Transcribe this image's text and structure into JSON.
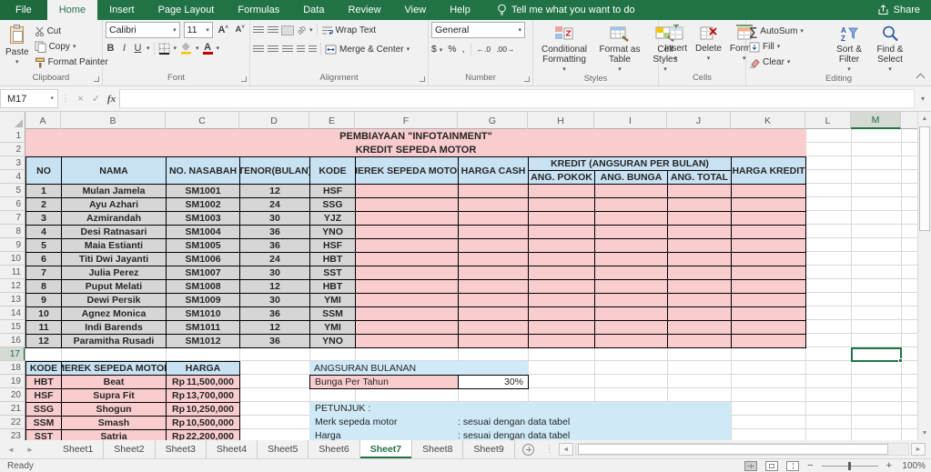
{
  "ribbon": {
    "file_tab": "File",
    "tabs": [
      "Home",
      "Insert",
      "Page Layout",
      "Formulas",
      "Data",
      "Review",
      "View",
      "Help"
    ],
    "active_tab": "Home",
    "tell_me": "Tell me what you want to do",
    "share": "Share",
    "groups": {
      "clipboard": {
        "label": "Clipboard",
        "paste": "Paste",
        "cut": "Cut",
        "copy": "Copy",
        "format_painter": "Format Painter"
      },
      "font": {
        "label": "Font",
        "font_name": "Calibri",
        "font_size": "11",
        "bold": "B",
        "italic": "I",
        "underline": "U"
      },
      "alignment": {
        "label": "Alignment",
        "wrap_text": "Wrap Text",
        "merge_center": "Merge & Center"
      },
      "number": {
        "label": "Number",
        "format": "General",
        "currency": "$",
        "percent": "%",
        "comma": ",",
        "inc_decimal": "←.0",
        "dec_decimal": ".00→"
      },
      "styles": {
        "label": "Styles",
        "conditional": "Conditional Formatting",
        "format_table": "Format as Table",
        "cell_styles": "Cell Styles"
      },
      "cells": {
        "label": "Cells",
        "insert": "Insert",
        "delete": "Delete",
        "format": "Format"
      },
      "editing": {
        "label": "Editing",
        "autosum": "AutoSum",
        "fill": "Fill",
        "clear": "Clear",
        "sort": "Sort & Filter",
        "find": "Find & Select"
      }
    }
  },
  "formula_bar": {
    "name_box": "M17",
    "fx": "fx",
    "formula": ""
  },
  "grid": {
    "columns": [
      "A",
      "B",
      "C",
      "D",
      "E",
      "F",
      "G",
      "H",
      "I",
      "J",
      "K",
      "L",
      "M"
    ],
    "row_count": 23,
    "selected_cell": "M17",
    "selected_column": "M",
    "selected_row": 17,
    "title_line1": "PEMBIAYAAN \"INFOTAINMENT\"",
    "title_line2": "KREDIT SEPEDA MOTOR",
    "main_table": {
      "headers": {
        "no": "NO",
        "nama": "NAMA",
        "nasabah": "NO. NASABAH",
        "tenor": "TENOR(BULAN)",
        "kode": "KODE",
        "merek": "MEREK SEPEDA MOTOR",
        "harga_cash": "HARGA CASH",
        "kredit_group": "KREDIT (ANGSURAN PER BULAN)",
        "ang_pokok": "ANG. POKOK",
        "ang_bunga": "ANG. BUNGA",
        "ang_total": "ANG. TOTAL",
        "harga_kredit": "HARGA KREDIT"
      },
      "rows": [
        [
          "1",
          "Mulan Jamela",
          "SM1001",
          "12",
          "HSF"
        ],
        [
          "2",
          "Ayu Azhari",
          "SM1002",
          "24",
          "SSG"
        ],
        [
          "3",
          "Azmirandah",
          "SM1003",
          "30",
          "YJZ"
        ],
        [
          "4",
          "Desi Ratnasari",
          "SM1004",
          "36",
          "YNO"
        ],
        [
          "5",
          "Maia Estianti",
          "SM1005",
          "36",
          "HSF"
        ],
        [
          "6",
          "Titi Dwi Jayanti",
          "SM1006",
          "24",
          "HBT"
        ],
        [
          "7",
          "Julia Perez",
          "SM1007",
          "30",
          "SST"
        ],
        [
          "8",
          "Puput Melati",
          "SM1008",
          "12",
          "HBT"
        ],
        [
          "9",
          "Dewi Persik",
          "SM1009",
          "30",
          "YMI"
        ],
        [
          "10",
          "Agnez Monica",
          "SM1010",
          "36",
          "SSM"
        ],
        [
          "11",
          "Indi Barends",
          "SM1011",
          "12",
          "YMI"
        ],
        [
          "12",
          "Paramitha Rusadi",
          "SM1012",
          "36",
          "YNO"
        ]
      ]
    },
    "lookup_table": {
      "headers": [
        "KODE",
        "MEREK SEPEDA MOTOR",
        "HARGA"
      ],
      "currency": "Rp",
      "rows": [
        [
          "HBT",
          "Beat",
          "11,500,000"
        ],
        [
          "HSF",
          "Supra Fit",
          "13,700,000"
        ],
        [
          "SSG",
          "Shogun",
          "10,250,000"
        ],
        [
          "SSM",
          "Smash",
          "10,500,000"
        ],
        [
          "SST",
          "Satria",
          "22,200,000"
        ]
      ]
    },
    "angsuran": {
      "title": "ANGSURAN BULANAN",
      "label": "Bunga Per Tahun",
      "value": "30%"
    },
    "petunjuk": {
      "title": "PETUNJUK :",
      "rows": [
        {
          "label": "Merk sepeda motor",
          "value": ": sesuai dengan data tabel"
        },
        {
          "label": "Harga",
          "value": ": sesuai dengan data tabel"
        }
      ]
    }
  },
  "sheet_tabs": {
    "tabs": [
      "Sheet1",
      "Sheet2",
      "Sheet3",
      "Sheet4",
      "Sheet5",
      "Sheet6",
      "Sheet7",
      "Sheet8",
      "Sheet9"
    ],
    "active": "Sheet7"
  },
  "status_bar": {
    "status": "Ready",
    "zoom": "100%"
  },
  "colors": {
    "green": "#217346",
    "pink": "#F9CDCE",
    "header_blue": "#C9E2F3",
    "note_blue": "#CFE9F7",
    "cell_gray": "#D6D6D6",
    "grid_line": "#D8D8D8"
  }
}
